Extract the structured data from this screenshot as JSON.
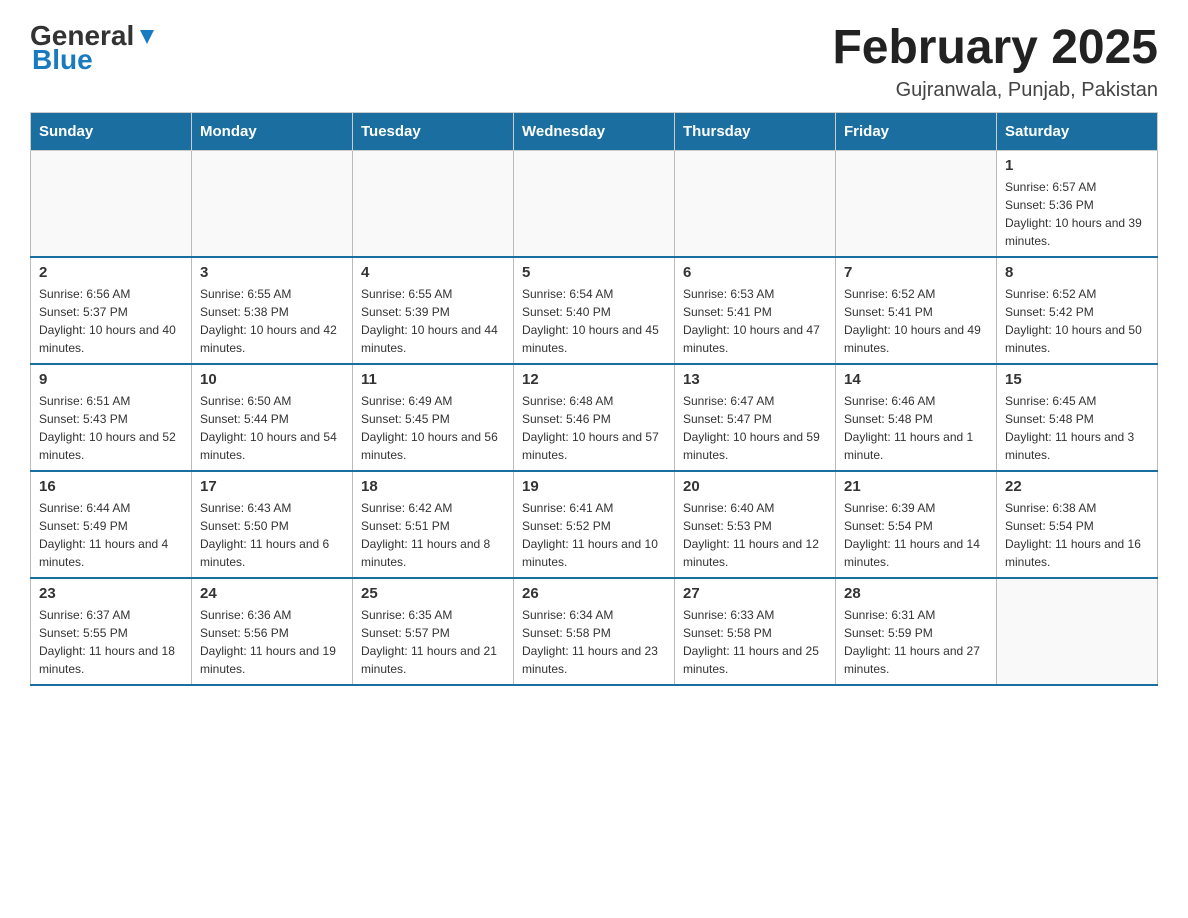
{
  "header": {
    "logo_general": "General",
    "logo_blue": "Blue",
    "month_title": "February 2025",
    "location": "Gujranwala, Punjab, Pakistan"
  },
  "days_of_week": [
    "Sunday",
    "Monday",
    "Tuesday",
    "Wednesday",
    "Thursday",
    "Friday",
    "Saturday"
  ],
  "weeks": [
    [
      {
        "day": "",
        "info": ""
      },
      {
        "day": "",
        "info": ""
      },
      {
        "day": "",
        "info": ""
      },
      {
        "day": "",
        "info": ""
      },
      {
        "day": "",
        "info": ""
      },
      {
        "day": "",
        "info": ""
      },
      {
        "day": "1",
        "info": "Sunrise: 6:57 AM\nSunset: 5:36 PM\nDaylight: 10 hours and 39 minutes."
      }
    ],
    [
      {
        "day": "2",
        "info": "Sunrise: 6:56 AM\nSunset: 5:37 PM\nDaylight: 10 hours and 40 minutes."
      },
      {
        "day": "3",
        "info": "Sunrise: 6:55 AM\nSunset: 5:38 PM\nDaylight: 10 hours and 42 minutes."
      },
      {
        "day": "4",
        "info": "Sunrise: 6:55 AM\nSunset: 5:39 PM\nDaylight: 10 hours and 44 minutes."
      },
      {
        "day": "5",
        "info": "Sunrise: 6:54 AM\nSunset: 5:40 PM\nDaylight: 10 hours and 45 minutes."
      },
      {
        "day": "6",
        "info": "Sunrise: 6:53 AM\nSunset: 5:41 PM\nDaylight: 10 hours and 47 minutes."
      },
      {
        "day": "7",
        "info": "Sunrise: 6:52 AM\nSunset: 5:41 PM\nDaylight: 10 hours and 49 minutes."
      },
      {
        "day": "8",
        "info": "Sunrise: 6:52 AM\nSunset: 5:42 PM\nDaylight: 10 hours and 50 minutes."
      }
    ],
    [
      {
        "day": "9",
        "info": "Sunrise: 6:51 AM\nSunset: 5:43 PM\nDaylight: 10 hours and 52 minutes."
      },
      {
        "day": "10",
        "info": "Sunrise: 6:50 AM\nSunset: 5:44 PM\nDaylight: 10 hours and 54 minutes."
      },
      {
        "day": "11",
        "info": "Sunrise: 6:49 AM\nSunset: 5:45 PM\nDaylight: 10 hours and 56 minutes."
      },
      {
        "day": "12",
        "info": "Sunrise: 6:48 AM\nSunset: 5:46 PM\nDaylight: 10 hours and 57 minutes."
      },
      {
        "day": "13",
        "info": "Sunrise: 6:47 AM\nSunset: 5:47 PM\nDaylight: 10 hours and 59 minutes."
      },
      {
        "day": "14",
        "info": "Sunrise: 6:46 AM\nSunset: 5:48 PM\nDaylight: 11 hours and 1 minute."
      },
      {
        "day": "15",
        "info": "Sunrise: 6:45 AM\nSunset: 5:48 PM\nDaylight: 11 hours and 3 minutes."
      }
    ],
    [
      {
        "day": "16",
        "info": "Sunrise: 6:44 AM\nSunset: 5:49 PM\nDaylight: 11 hours and 4 minutes."
      },
      {
        "day": "17",
        "info": "Sunrise: 6:43 AM\nSunset: 5:50 PM\nDaylight: 11 hours and 6 minutes."
      },
      {
        "day": "18",
        "info": "Sunrise: 6:42 AM\nSunset: 5:51 PM\nDaylight: 11 hours and 8 minutes."
      },
      {
        "day": "19",
        "info": "Sunrise: 6:41 AM\nSunset: 5:52 PM\nDaylight: 11 hours and 10 minutes."
      },
      {
        "day": "20",
        "info": "Sunrise: 6:40 AM\nSunset: 5:53 PM\nDaylight: 11 hours and 12 minutes."
      },
      {
        "day": "21",
        "info": "Sunrise: 6:39 AM\nSunset: 5:54 PM\nDaylight: 11 hours and 14 minutes."
      },
      {
        "day": "22",
        "info": "Sunrise: 6:38 AM\nSunset: 5:54 PM\nDaylight: 11 hours and 16 minutes."
      }
    ],
    [
      {
        "day": "23",
        "info": "Sunrise: 6:37 AM\nSunset: 5:55 PM\nDaylight: 11 hours and 18 minutes."
      },
      {
        "day": "24",
        "info": "Sunrise: 6:36 AM\nSunset: 5:56 PM\nDaylight: 11 hours and 19 minutes."
      },
      {
        "day": "25",
        "info": "Sunrise: 6:35 AM\nSunset: 5:57 PM\nDaylight: 11 hours and 21 minutes."
      },
      {
        "day": "26",
        "info": "Sunrise: 6:34 AM\nSunset: 5:58 PM\nDaylight: 11 hours and 23 minutes."
      },
      {
        "day": "27",
        "info": "Sunrise: 6:33 AM\nSunset: 5:58 PM\nDaylight: 11 hours and 25 minutes."
      },
      {
        "day": "28",
        "info": "Sunrise: 6:31 AM\nSunset: 5:59 PM\nDaylight: 11 hours and 27 minutes."
      },
      {
        "day": "",
        "info": ""
      }
    ]
  ]
}
